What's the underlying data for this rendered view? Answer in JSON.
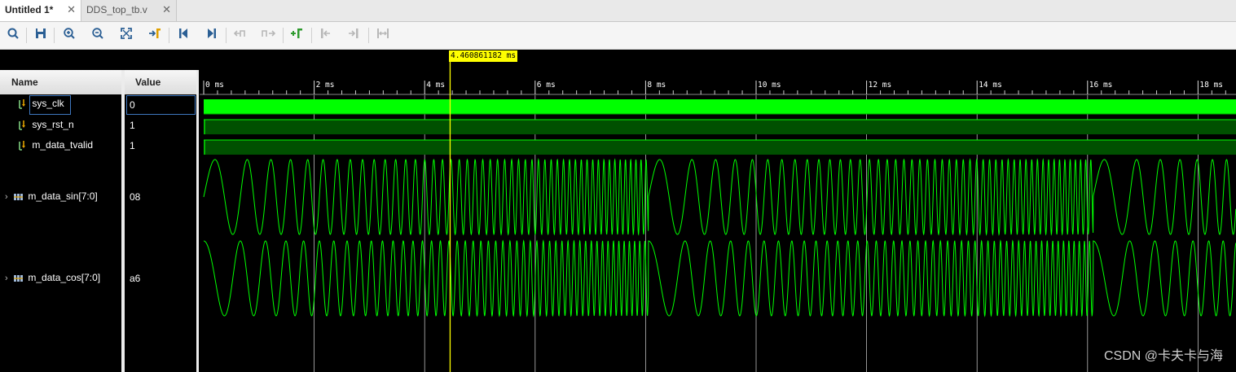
{
  "tabs": [
    {
      "label": "Untitled 1*",
      "close": "✕"
    },
    {
      "label": "DDS_top_tb.v",
      "close": "✕"
    }
  ],
  "toolbar": {
    "icons": [
      "search-icon",
      "save-icon",
      "zoom-in-icon",
      "zoom-out-icon",
      "zoom-fit-icon",
      "go-to-cursor-icon",
      "go-to-time-0-icon",
      "go-to-last-time-icon",
      "previous-transition-icon",
      "next-transition-icon",
      "add-marker-icon",
      "previous-marker-icon",
      "next-marker-icon",
      "swap-cursors-icon"
    ]
  },
  "columns": {
    "name": "Name",
    "value": "Value"
  },
  "signals": [
    {
      "name": "sys_clk",
      "value": "0",
      "kind": "bit"
    },
    {
      "name": "sys_rst_n",
      "value": "1",
      "kind": "bit"
    },
    {
      "name": "m_data_tvalid",
      "value": "1",
      "kind": "bit"
    },
    {
      "name": "m_data_sin[7:0]",
      "value": "08",
      "kind": "bus"
    },
    {
      "name": "m_data_cos[7:0]",
      "value": "a6",
      "kind": "bus"
    }
  ],
  "cursor": {
    "time_label": "4.460861182 ms",
    "time_ms": 4.460861182
  },
  "ruler": {
    "labels": [
      "0 ms",
      "2 ms",
      "4 ms",
      "6 ms",
      "8 ms",
      "10 ms",
      "12 ms",
      "14 ms",
      "16 ms",
      "18 ms"
    ],
    "start_ms": 0,
    "end_ms": 18.75
  },
  "colors": {
    "wave": "#00ff00",
    "bus_fill": "#005000",
    "cursor": "#ffff00",
    "grid": "#bbbbbb"
  },
  "watermark": "CSDN @卡夫卡与海"
}
